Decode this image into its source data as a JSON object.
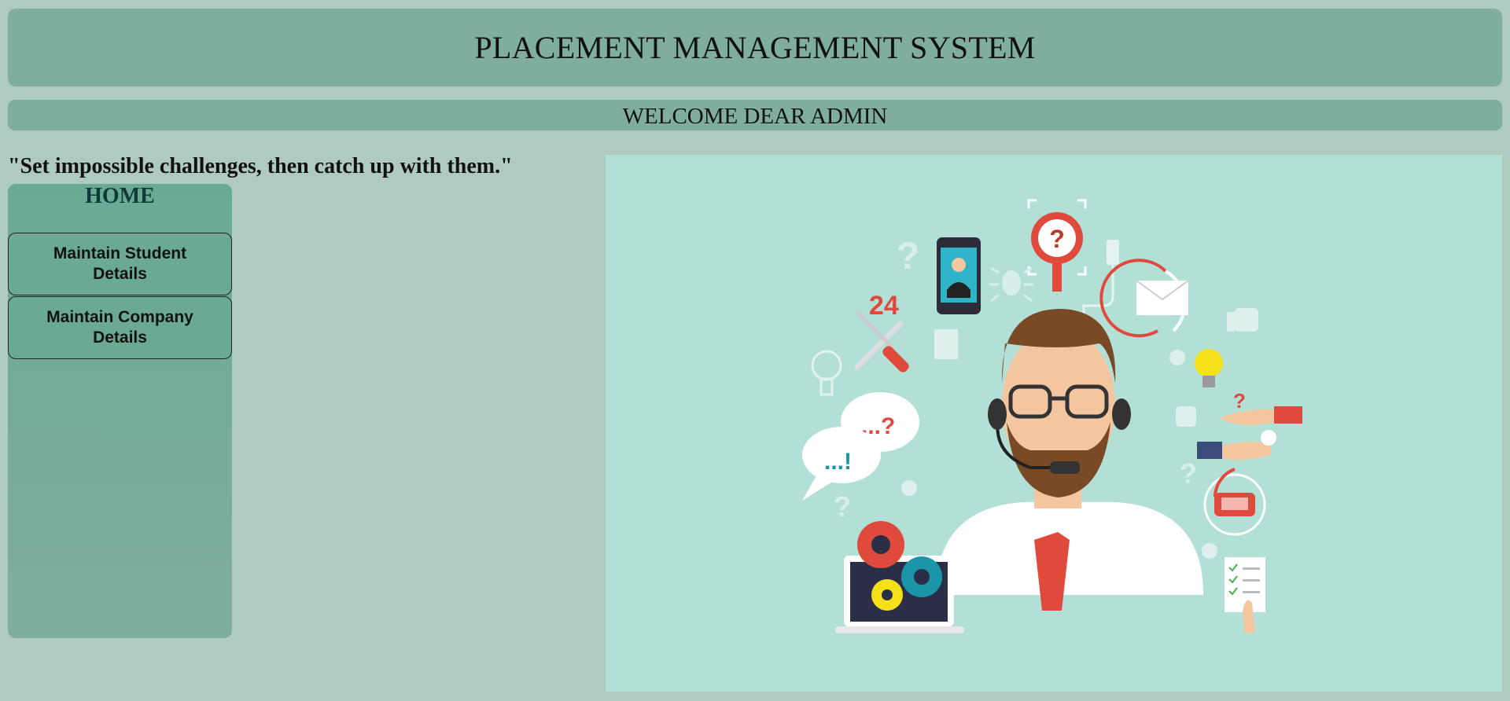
{
  "header": {
    "title": "PLACEMENT MANAGEMENT SYSTEM"
  },
  "welcome": {
    "text": "WELCOME DEAR ADMIN"
  },
  "quote": "\"Set impossible challenges, then catch up with them.\"",
  "sidebar": {
    "home_label": "HOME",
    "items": [
      {
        "label": "Maintain Student Details"
      },
      {
        "label": "Maintain Company Details"
      }
    ]
  },
  "illustration": {
    "label_24": "24",
    "bubble_1": "...?",
    "bubble_2": "...!"
  },
  "colors": {
    "page_bg": "#afcbbf",
    "header_bg": "#7fae9c",
    "sidebar_bg": "#6aaa93",
    "illustration_bg": "#b2e0d6",
    "accent_red": "#e04a3d"
  }
}
